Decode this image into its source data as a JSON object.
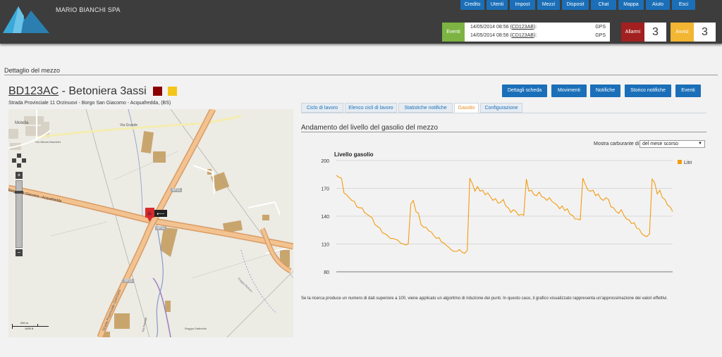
{
  "header": {
    "company_name": "MARIO BIANCHI SPA",
    "nav": [
      {
        "label": "Credito"
      },
      {
        "label": "Utenti"
      },
      {
        "label": "Impost"
      },
      {
        "label": "Mezzi"
      },
      {
        "label": "Disposit"
      },
      {
        "label": "Chat"
      },
      {
        "label": "Mappa"
      },
      {
        "label": "Aiuto"
      },
      {
        "label": "Esci"
      }
    ],
    "events": {
      "label": "Eventi",
      "items": [
        {
          "datetime": "14/05/2014 08:56",
          "code": "CD123AB",
          "suffix": ":",
          "type": "GPS"
        },
        {
          "datetime": "14/05/2014 08:56",
          "code": "CD123AB",
          "suffix": ":",
          "type": "GPS"
        }
      ]
    },
    "alarms": {
      "label": "Allarmi",
      "count": "3"
    },
    "warnings": {
      "label": "Avvisi",
      "count": "3"
    }
  },
  "page": {
    "section_title": "Dettaglio del mezzo",
    "vehicle_code": "BD123AC",
    "vehicle_name": " - Betoniera 3assi",
    "address": "Strada Provinciale 11 Orzinuovi - Borgo San Giacomo - Acquafredda, (BS)",
    "status_colors": [
      "#8b0000",
      "#f5c518"
    ]
  },
  "actions": [
    {
      "label": "Dettagli scheda"
    },
    {
      "label": "Movimenti"
    },
    {
      "label": "Notifiche"
    },
    {
      "label": "Storico notifiche"
    },
    {
      "label": "Eventi"
    }
  ],
  "tabs": [
    {
      "label": "Ciclo di lavoro",
      "active": false
    },
    {
      "label": "Elenco cicli di lavoro",
      "active": false
    },
    {
      "label": "Statistiche notifiche",
      "active": false
    },
    {
      "label": "Gasolio",
      "active": true
    },
    {
      "label": "Configurazione",
      "active": false
    }
  ],
  "fuel": {
    "heading": "Andamento del livello del gasolio del mezzo",
    "filter_label": "Mostra carburante di",
    "filter_value": "del mese scorso",
    "disclaimer": "Se la ricerca produce un numero di dati superiore a 100, viene applicato un algoritmo di riduzione dei punti. In questo caso, il grafico visualizzato rappresenta un'approssimazione dei valori effettivi."
  },
  "map": {
    "labels": [
      "Motella",
      "Via Vittorio Bachelet",
      "Via Grande",
      "Borgo San Giacomo - Acquafredda",
      "SP11",
      "SP11",
      "SP11",
      "Strada Provinciale Quinzano",
      "Via Prestale",
      "Roggia Gattinella",
      "Roggia Bedone"
    ],
    "scale_top": "200 m",
    "scale_bottom": "1000 ft",
    "zoom_in": "+",
    "zoom_out": "−"
  },
  "chart_data": {
    "type": "line",
    "title": "Livello gasolio",
    "series": [
      {
        "name": "Litri",
        "color": "#f29c11",
        "values": [
          184,
          182,
          181,
          165,
          163,
          160,
          157,
          156,
          150,
          149,
          149,
          144,
          142,
          140,
          138,
          131,
          129,
          127,
          122,
          121,
          119,
          116,
          116,
          115,
          114,
          111,
          110,
          109,
          110,
          153,
          157,
          145,
          143,
          131,
          128,
          128,
          124,
          123,
          119,
          116,
          117,
          112,
          111,
          108,
          106,
          103,
          102,
          102,
          104,
          101,
          100,
          103,
          181,
          175,
          167,
          172,
          167,
          168,
          163,
          165,
          161,
          157,
          159,
          154,
          155,
          158,
          151,
          149,
          144,
          147,
          145,
          141,
          142,
          141,
          180,
          167,
          168,
          163,
          162,
          166,
          161,
          160,
          157,
          160,
          156,
          154,
          152,
          148,
          151,
          146,
          148,
          142,
          141,
          137,
          137,
          136,
          181,
          174,
          168,
          167,
          168,
          162,
          164,
          159,
          157,
          160,
          158,
          150,
          149,
          145,
          143,
          147,
          141,
          137,
          136,
          132,
          133,
          127,
          126,
          121,
          119,
          118,
          121,
          180,
          176,
          164,
          168,
          160,
          158,
          152,
          150,
          145
        ]
      }
    ],
    "ylim": [
      80,
      200
    ],
    "yticks": [
      "80",
      "110",
      "140",
      "170",
      "200"
    ],
    "legend_position": "top-right"
  }
}
